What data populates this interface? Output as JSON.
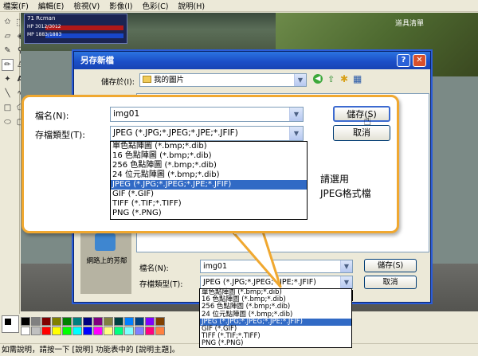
{
  "menubar": [
    "檔案(F)",
    "編輯(E)",
    "檢視(V)",
    "影像(I)",
    "色彩(C)",
    "說明(H)"
  ],
  "game": {
    "name": "71 Rcman",
    "hp": "HP  3012/3012",
    "mp": "MP  1883/1883",
    "shop": "道具清單"
  },
  "dialog": {
    "title": "另存新檔",
    "save_in_label": "儲存於(I):",
    "save_in_value": "我的圖片",
    "sidebar_label": "網路上的芳鄰",
    "filename_label": "檔名(N):",
    "filename_value": "img01",
    "filetype_label": "存檔類型(T):",
    "filetype_value": "JPEG (*.JPG;*.JPEG;*.JPE;*.JFIF)",
    "save_button": "儲存(S)",
    "cancel_button": "取消",
    "filetypes": [
      "單色點陣圖 (*.bmp;*.dib)",
      "16 色點陣圖 (*.bmp;*.dib)",
      "256 色點陣圖 (*.bmp;*.dib)",
      "24 位元點陣圖 (*.bmp;*.dib)",
      "JPEG (*.JPG;*.JPEG;*.JPE;*.JFIF)",
      "GIF (*.GIF)",
      "TIFF (*.TIF;*.TIFF)",
      "PNG (*.PNG)"
    ],
    "selected_index": 4
  },
  "callout": {
    "filename_label": "檔名(N):",
    "filename_value": "img01",
    "filetype_label": "存檔類型(T):",
    "filetype_value": "JPEG (*.JPG;*.JPEG;*.JPE;*.JFIF)",
    "save_button": "儲存(S)",
    "cancel_button": "取消",
    "note_line1": "請選用",
    "note_line2": "JPEG格式檔"
  },
  "statusbar": "如需說明，請按一下 [說明] 功能表中的 [說明主題]。",
  "palette_colors": [
    "#000000",
    "#808080",
    "#800000",
    "#808000",
    "#008000",
    "#008080",
    "#000080",
    "#800080",
    "#808040",
    "#004040",
    "#0080ff",
    "#004080",
    "#8000ff",
    "#804000",
    "#ffffff",
    "#c0c0c0",
    "#ff0000",
    "#ffff00",
    "#00ff00",
    "#00ffff",
    "#0000ff",
    "#ff00ff",
    "#ffff80",
    "#00ff80",
    "#80ffff",
    "#8080ff",
    "#ff0080",
    "#ff8040"
  ]
}
